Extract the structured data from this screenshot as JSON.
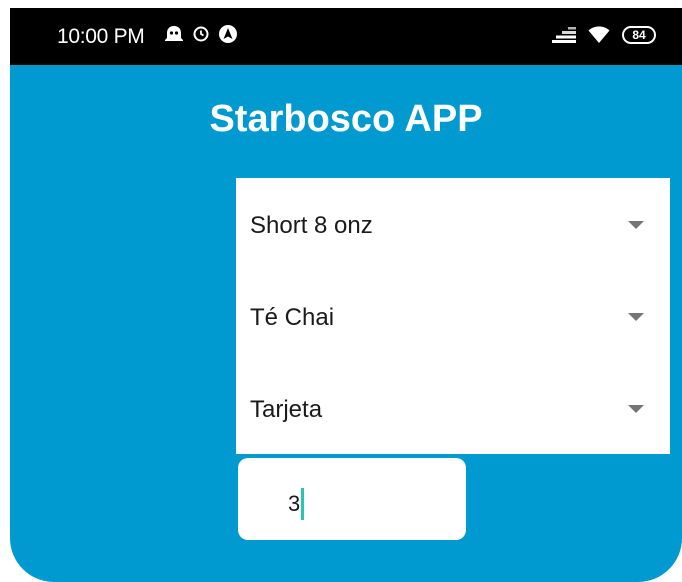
{
  "status_bar": {
    "time": "10:00 PM",
    "left_icons": [
      "ghost-icon",
      "alarm-icon",
      "navigation-icon"
    ],
    "right_icons": [
      "signal-icon",
      "wifi-icon",
      "battery-icon"
    ],
    "battery_level": "84"
  },
  "app": {
    "title": "Starbosco APP"
  },
  "form": {
    "size_spinner": "Short 8 onz",
    "drink_spinner": "Té Chai",
    "payment_spinner": "Tarjeta",
    "quantity_value": "3"
  },
  "colors": {
    "app_background": "#0099d0",
    "status_bar": "#000000",
    "panel": "#ffffff",
    "cursor": "#26c6b0"
  }
}
